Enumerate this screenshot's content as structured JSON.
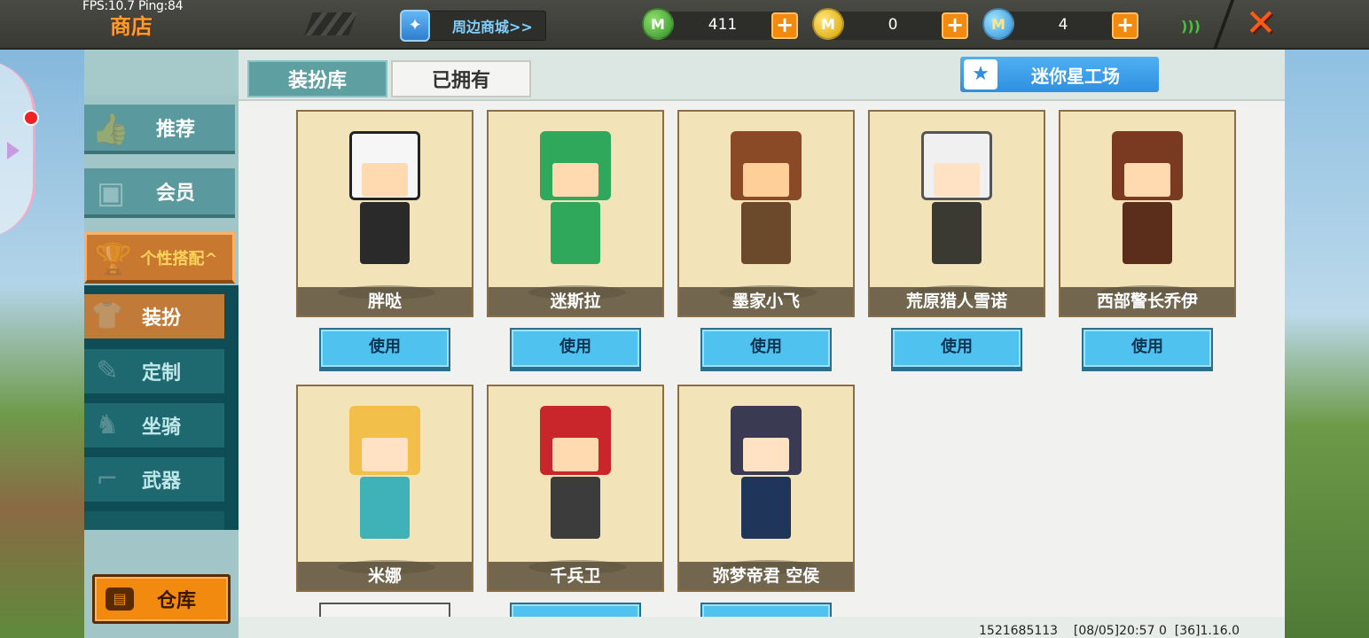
{
  "debug": {
    "fps_text": "FPS:10.7  Ping:84"
  },
  "header": {
    "title": "商店",
    "mall_label": "周边商城>>",
    "currencies": [
      {
        "icon": "green-mini-coin-icon",
        "value": "411"
      },
      {
        "icon": "gold-m-coin-icon",
        "value": "0"
      },
      {
        "icon": "blue-mini-bean-icon",
        "value": "4"
      }
    ]
  },
  "sidebar": {
    "items": [
      {
        "label": "推荐",
        "icon": "thumbs-up-icon"
      },
      {
        "label": "会员",
        "icon": "vip-icon"
      },
      {
        "label": "个性搭配^",
        "icon": "trophy-icon"
      }
    ],
    "sub_items": [
      {
        "label": "装扮",
        "icon": "shirt-icon"
      },
      {
        "label": "定制",
        "icon": "pencil-icon"
      },
      {
        "label": "坐骑",
        "icon": "mount-icon"
      },
      {
        "label": "武器",
        "icon": "gun-icon"
      }
    ],
    "warehouse_label": "仓库"
  },
  "tabs": [
    {
      "label": "装扮库"
    },
    {
      "label": "已拥有"
    }
  ],
  "workshop_label": "迷你星工场",
  "skins": [
    {
      "name": "胖哒",
      "button": "使用"
    },
    {
      "name": "迷斯拉",
      "button": "使用"
    },
    {
      "name": "墨家小飞",
      "button": "使用"
    },
    {
      "name": "荒原猎人雪诺",
      "button": "使用"
    },
    {
      "name": "西部警长乔伊",
      "button": "使用"
    },
    {
      "name": "米娜",
      "button": ""
    },
    {
      "name": "千兵卫",
      "button": ""
    },
    {
      "name": "弥梦帝君 空侯",
      "button": ""
    }
  ],
  "footer": {
    "info": "1521685113    [08/05]20:57 0  [36]1.16.0"
  },
  "colors": {
    "accent_orange": "#f28a10",
    "teal": "#5e9fa2",
    "use_button": "#4fc2ef",
    "card_bg": "#f3e3b8"
  }
}
